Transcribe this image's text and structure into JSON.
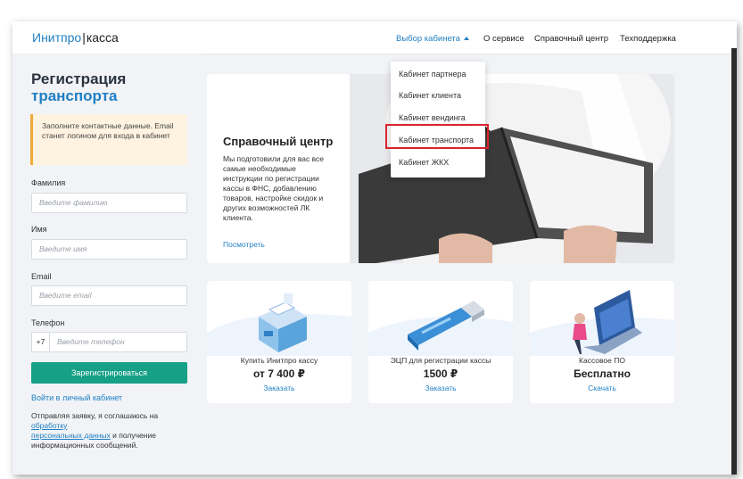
{
  "header": {
    "logo_brand": "Инитпро",
    "logo_sep": "|",
    "logo_product": "касса",
    "nav": [
      {
        "label": "Выбор кабинета"
      },
      {
        "label": "О сервисе"
      },
      {
        "label": "Справочный центр"
      },
      {
        "label": "Техподдержка"
      }
    ]
  },
  "dropdown": {
    "items": [
      {
        "label": "Кабинет партнера"
      },
      {
        "label": "Кабинет клиента"
      },
      {
        "label": "Кабинет вендинга"
      },
      {
        "label": "Кабинет транспорта"
      },
      {
        "label": "Кабинет ЖКХ"
      }
    ],
    "highlighted_index": 3
  },
  "registration": {
    "title_line1": "Регистрация",
    "title_line2": "транспорта",
    "notice": "Заполните контактные данные. Email станет логином для входа в кабинет",
    "fields": [
      {
        "label": "Фамилия",
        "placeholder": "Введите фамилию"
      },
      {
        "label": "Имя",
        "placeholder": "Введите имя"
      },
      {
        "label": "Email",
        "placeholder": "Введите email"
      },
      {
        "label": "Телефон",
        "prefix": "+7",
        "placeholder": "Введите телефон"
      }
    ],
    "submit": "Зарегистрироваться",
    "login_link": "Войти в личный кабинет",
    "consent_prefix": "Отправляя заявку, я соглашаюсь на",
    "consent_link1": "обработку",
    "consent_link2": "персональных данных",
    "consent_suffix": " и получение информационных сообщений."
  },
  "help_center": {
    "title": "Справочный центр",
    "text": "Мы подготовили для вас все самые необходимые инструкции по регистрации кассы в ФНС, добавлению товаров, настройке скидок и других возможностей ЛК клиента.",
    "link": "Посмотреть"
  },
  "cards": [
    {
      "caption": "Купить Инитпро кассу",
      "price": "от 7 400 ₽",
      "action": "Заказать"
    },
    {
      "caption": "ЭЦП для регистрации кассы",
      "price": "1500 ₽",
      "action": "Заказать"
    },
    {
      "caption": "Кассовое ПО",
      "price": "Бесплатно",
      "action": "Скачать"
    }
  ],
  "colors": {
    "brand": "#1f7fc4",
    "accent_green": "#16a085",
    "highlight": "#d9232e",
    "notice_border": "#f1a93a"
  }
}
